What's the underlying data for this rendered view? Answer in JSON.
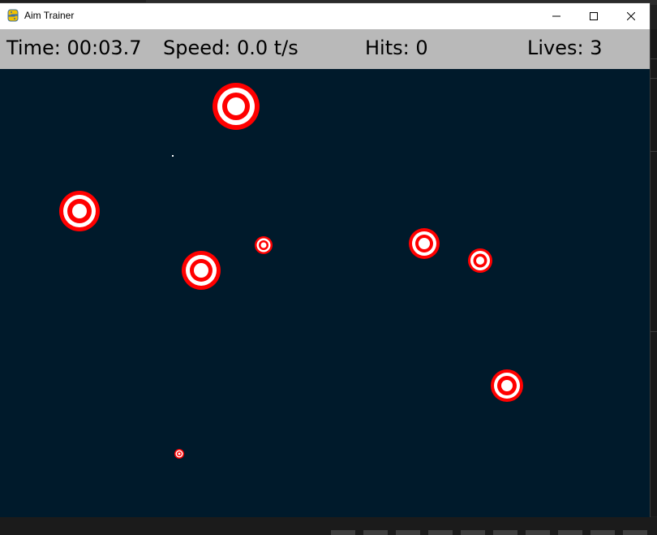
{
  "window": {
    "title": "Aim Trainer",
    "controls": [
      "minimize",
      "maximize",
      "close"
    ]
  },
  "hud": {
    "time": "Time: 00:03.7",
    "speed": "Speed: 0.0 t/s",
    "hits": "Hits: 0",
    "lives": "Lives: 3"
  },
  "colors": {
    "playfield": "#001a2b",
    "hud_bar": "#b9b9b9",
    "target_red": "#ff0000",
    "target_white": "#ffffff"
  },
  "targets_count": 9
}
